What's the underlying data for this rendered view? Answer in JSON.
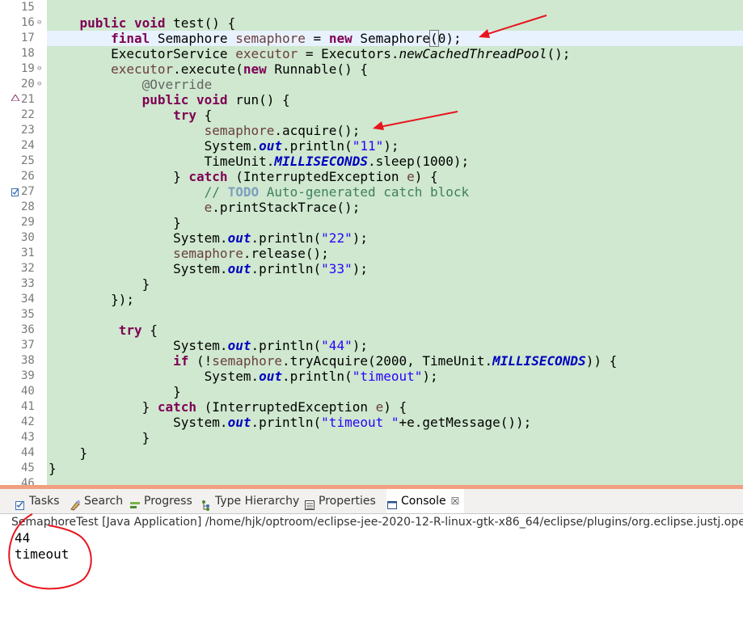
{
  "editor": {
    "lines": [
      {
        "n": "15",
        "fold": "",
        "marker": "",
        "highlight": false,
        "segments": []
      },
      {
        "n": "16",
        "fold": "⊖",
        "marker": "",
        "highlight": false,
        "segments": [
          {
            "t": "    "
          },
          {
            "t": "public",
            "c": "kw"
          },
          {
            "t": " "
          },
          {
            "t": "void",
            "c": "kw"
          },
          {
            "t": " test() {"
          }
        ]
      },
      {
        "n": "17",
        "fold": "",
        "marker": "",
        "highlight": true,
        "segments": [
          {
            "t": "        "
          },
          {
            "t": "final",
            "c": "kw"
          },
          {
            "t": " Semaphore "
          },
          {
            "t": "semaphore",
            "c": "fld"
          },
          {
            "t": " = "
          },
          {
            "t": "new",
            "c": "kw"
          },
          {
            "t": " Semaphore"
          },
          {
            "t": "(",
            "c": "caretbox"
          },
          {
            "t": "0);"
          }
        ]
      },
      {
        "n": "18",
        "fold": "",
        "marker": "",
        "highlight": false,
        "segments": [
          {
            "t": "        ExecutorService "
          },
          {
            "t": "executor",
            "c": "fld"
          },
          {
            "t": " = Executors."
          },
          {
            "t": "newCachedThreadPool",
            "c": "it"
          },
          {
            "t": "();"
          }
        ]
      },
      {
        "n": "19",
        "fold": "⊖",
        "marker": "",
        "highlight": false,
        "segments": [
          {
            "t": "        "
          },
          {
            "t": "executor",
            "c": "fld"
          },
          {
            "t": ".execute("
          },
          {
            "t": "new",
            "c": "kw"
          },
          {
            "t": " Runnable() {"
          }
        ]
      },
      {
        "n": "20",
        "fold": "⊖",
        "marker": "",
        "highlight": false,
        "segments": [
          {
            "t": "            "
          },
          {
            "t": "@Override",
            "c": "ann"
          }
        ]
      },
      {
        "n": "21",
        "fold": "",
        "marker": "override",
        "highlight": false,
        "segments": [
          {
            "t": "            "
          },
          {
            "t": "public",
            "c": "kw"
          },
          {
            "t": " "
          },
          {
            "t": "void",
            "c": "kw"
          },
          {
            "t": " run() {"
          }
        ]
      },
      {
        "n": "22",
        "fold": "",
        "marker": "",
        "highlight": false,
        "segments": [
          {
            "t": "                "
          },
          {
            "t": "try",
            "c": "kw"
          },
          {
            "t": " {"
          }
        ]
      },
      {
        "n": "23",
        "fold": "",
        "marker": "",
        "highlight": false,
        "segments": [
          {
            "t": "                    "
          },
          {
            "t": "semaphore",
            "c": "fld"
          },
          {
            "t": ".acquire();"
          }
        ]
      },
      {
        "n": "24",
        "fold": "",
        "marker": "",
        "highlight": false,
        "segments": [
          {
            "t": "                    System."
          },
          {
            "t": "out",
            "c": "sf"
          },
          {
            "t": ".println("
          },
          {
            "t": "\"11\"",
            "c": "str"
          },
          {
            "t": ");"
          }
        ]
      },
      {
        "n": "25",
        "fold": "",
        "marker": "",
        "highlight": false,
        "segments": [
          {
            "t": "                    TimeUnit."
          },
          {
            "t": "MILLISECONDS",
            "c": "sf"
          },
          {
            "t": ".sleep(1000);"
          }
        ]
      },
      {
        "n": "26",
        "fold": "",
        "marker": "",
        "highlight": false,
        "segments": [
          {
            "t": "                } "
          },
          {
            "t": "catch",
            "c": "kw"
          },
          {
            "t": " (InterruptedException "
          },
          {
            "t": "e",
            "c": "fld"
          },
          {
            "t": ") {"
          }
        ]
      },
      {
        "n": "27",
        "fold": "",
        "marker": "task",
        "highlight": false,
        "segments": [
          {
            "t": "                    "
          },
          {
            "t": "// ",
            "c": "cm"
          },
          {
            "t": "TODO",
            "c": "todo"
          },
          {
            "t": " Auto-generated catch block",
            "c": "cm"
          }
        ]
      },
      {
        "n": "28",
        "fold": "",
        "marker": "",
        "highlight": false,
        "segments": [
          {
            "t": "                    "
          },
          {
            "t": "e",
            "c": "fld"
          },
          {
            "t": ".printStackTrace();"
          }
        ]
      },
      {
        "n": "29",
        "fold": "",
        "marker": "",
        "highlight": false,
        "segments": [
          {
            "t": "                }"
          }
        ]
      },
      {
        "n": "30",
        "fold": "",
        "marker": "",
        "highlight": false,
        "segments": [
          {
            "t": "                System."
          },
          {
            "t": "out",
            "c": "sf"
          },
          {
            "t": ".println("
          },
          {
            "t": "\"22\"",
            "c": "str"
          },
          {
            "t": ");"
          }
        ]
      },
      {
        "n": "31",
        "fold": "",
        "marker": "",
        "highlight": false,
        "segments": [
          {
            "t": "                "
          },
          {
            "t": "semaphore",
            "c": "fld"
          },
          {
            "t": ".release();"
          }
        ]
      },
      {
        "n": "32",
        "fold": "",
        "marker": "",
        "highlight": false,
        "segments": [
          {
            "t": "                System."
          },
          {
            "t": "out",
            "c": "sf"
          },
          {
            "t": ".println("
          },
          {
            "t": "\"33\"",
            "c": "str"
          },
          {
            "t": ");"
          }
        ]
      },
      {
        "n": "33",
        "fold": "",
        "marker": "",
        "highlight": false,
        "segments": [
          {
            "t": "            }"
          }
        ]
      },
      {
        "n": "34",
        "fold": "",
        "marker": "",
        "highlight": false,
        "segments": [
          {
            "t": "        });"
          }
        ]
      },
      {
        "n": "35",
        "fold": "",
        "marker": "",
        "highlight": false,
        "segments": []
      },
      {
        "n": "36",
        "fold": "",
        "marker": "",
        "highlight": false,
        "segments": [
          {
            "t": "         "
          },
          {
            "t": "try",
            "c": "kw"
          },
          {
            "t": " {"
          }
        ]
      },
      {
        "n": "37",
        "fold": "",
        "marker": "",
        "highlight": false,
        "segments": [
          {
            "t": "                System."
          },
          {
            "t": "out",
            "c": "sf"
          },
          {
            "t": ".println("
          },
          {
            "t": "\"44\"",
            "c": "str"
          },
          {
            "t": ");"
          }
        ]
      },
      {
        "n": "38",
        "fold": "",
        "marker": "",
        "highlight": false,
        "segments": [
          {
            "t": "                "
          },
          {
            "t": "if",
            "c": "kw"
          },
          {
            "t": " (!"
          },
          {
            "t": "semaphore",
            "c": "fld"
          },
          {
            "t": ".tryAcquire(2000, TimeUnit."
          },
          {
            "t": "MILLISECONDS",
            "c": "sf"
          },
          {
            "t": ")) {"
          }
        ]
      },
      {
        "n": "39",
        "fold": "",
        "marker": "",
        "highlight": false,
        "segments": [
          {
            "t": "                    System."
          },
          {
            "t": "out",
            "c": "sf"
          },
          {
            "t": ".println("
          },
          {
            "t": "\"timeout\"",
            "c": "str"
          },
          {
            "t": ");"
          }
        ]
      },
      {
        "n": "40",
        "fold": "",
        "marker": "",
        "highlight": false,
        "segments": [
          {
            "t": "                }"
          }
        ]
      },
      {
        "n": "41",
        "fold": "",
        "marker": "",
        "highlight": false,
        "segments": [
          {
            "t": "            } "
          },
          {
            "t": "catch",
            "c": "kw"
          },
          {
            "t": " (InterruptedException "
          },
          {
            "t": "e",
            "c": "fld"
          },
          {
            "t": ") {"
          }
        ]
      },
      {
        "n": "42",
        "fold": "",
        "marker": "",
        "highlight": false,
        "segments": [
          {
            "t": "                System."
          },
          {
            "t": "out",
            "c": "sf"
          },
          {
            "t": ".println("
          },
          {
            "t": "\"timeout \"",
            "c": "str"
          },
          {
            "t": "+e.getMessage());"
          }
        ]
      },
      {
        "n": "43",
        "fold": "",
        "marker": "",
        "highlight": false,
        "segments": [
          {
            "t": "            }"
          }
        ]
      },
      {
        "n": "44",
        "fold": "",
        "marker": "",
        "highlight": false,
        "segments": [
          {
            "t": "    }"
          }
        ]
      },
      {
        "n": "45",
        "fold": "",
        "marker": "",
        "highlight": false,
        "segments": [
          {
            "t": "}"
          }
        ]
      },
      {
        "n": "46",
        "fold": "",
        "marker": "",
        "highlight": false,
        "segments": []
      }
    ]
  },
  "views": {
    "tabs": [
      {
        "label": "Tasks",
        "icon": "tasks-icon",
        "active": false
      },
      {
        "label": "Search",
        "icon": "search-icon",
        "active": false
      },
      {
        "label": "Progress",
        "icon": "progress-icon",
        "active": false
      },
      {
        "label": "Type Hierarchy",
        "icon": "type-hierarchy-icon",
        "active": false
      },
      {
        "label": "Properties",
        "icon": "properties-icon",
        "active": false
      },
      {
        "label": "Console",
        "icon": "console-icon",
        "active": true,
        "close": "☒"
      }
    ]
  },
  "console": {
    "title": "SemaphoreTest [Java Application] /home/hjk/optroom/eclipse-jee-2020-12-R-linux-gtk-x86_64/eclipse/plugins/org.eclipse.justj.openjdk.hotspot.jre.full",
    "output": [
      "44",
      "timeout"
    ]
  },
  "colors": {
    "editor_bg": "#cfe8cf",
    "current_line": "#e8f2fe",
    "annotation_red": "#e8141e",
    "keyword": "#7f0055",
    "string": "#2a00ff",
    "static_field": "#0000c0"
  }
}
